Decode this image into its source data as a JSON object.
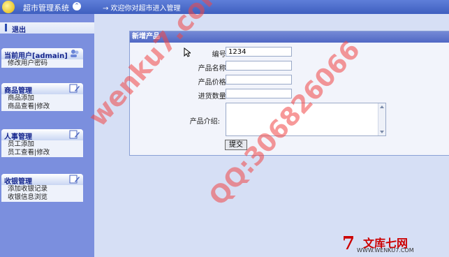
{
  "header": {
    "app_title": "超市管理系统",
    "collapse_glyph": "⌃",
    "welcome": "→ 欢迎你对超市进入管理"
  },
  "sidebar": {
    "logout": "退出",
    "panels": [
      {
        "title": "当前用户[admain]",
        "icon": "users-icon",
        "items": [
          "修改用户密码"
        ]
      },
      {
        "title": "商品管理",
        "icon": "edit-icon",
        "items": [
          "商品添加",
          "商品查看|修改"
        ]
      },
      {
        "title": "人事管理",
        "icon": "edit-icon",
        "items": [
          "员工添加",
          "员工查看|修改"
        ]
      },
      {
        "title": "收银管理",
        "icon": "edit-icon",
        "items": [
          "添加收银记录",
          "收银信息浏览"
        ]
      }
    ]
  },
  "form": {
    "title": "新增产品",
    "fields": [
      {
        "label": "编号:",
        "value": "1234"
      },
      {
        "label": "产品名称:",
        "value": ""
      },
      {
        "label": "产品价格:",
        "value": ""
      },
      {
        "label": "进货数量:",
        "value": ""
      }
    ],
    "description_label": "产品介绍:",
    "submit_label": "提交"
  },
  "watermark": {
    "line1": "wenku7.com",
    "line2": "QQ:306826066"
  },
  "brand": {
    "seven": "7",
    "name": "文库七网",
    "url": "WWW.WENKU7.COM"
  }
}
